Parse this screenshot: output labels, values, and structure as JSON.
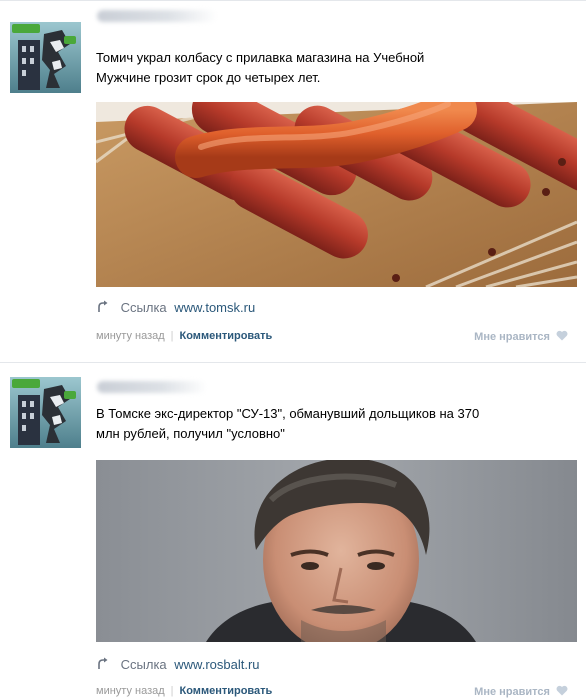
{
  "posts": [
    {
      "text_line1": "Томич украл колбасу с прилавка магазина на Учебной",
      "text_line2": "Мужчине грозит срок до четырех лет.",
      "link_prefix": "Ссылка",
      "link_url": "www.tomsk.ru",
      "time": "минуту назад",
      "separator": "|",
      "comment": "Комментировать",
      "like": "Мне нравится",
      "media_icon": "sausages-photo"
    },
    {
      "text_line1": "В Томске экс-директор \"СУ-13\", обманувший дольщиков на 370",
      "text_line2": "млн рублей, получил \"условно\"",
      "link_prefix": "Ссылка",
      "link_url": "www.rosbalt.ru",
      "time": "минуту назад",
      "separator": "|",
      "comment": "Комментировать",
      "like": "Мне нравится",
      "media_icon": "man-portrait-photo"
    }
  ],
  "colors": {
    "link": "#2b587a",
    "muted": "#999999",
    "like": "#aab6c4",
    "divider": "#e4e7eb"
  }
}
